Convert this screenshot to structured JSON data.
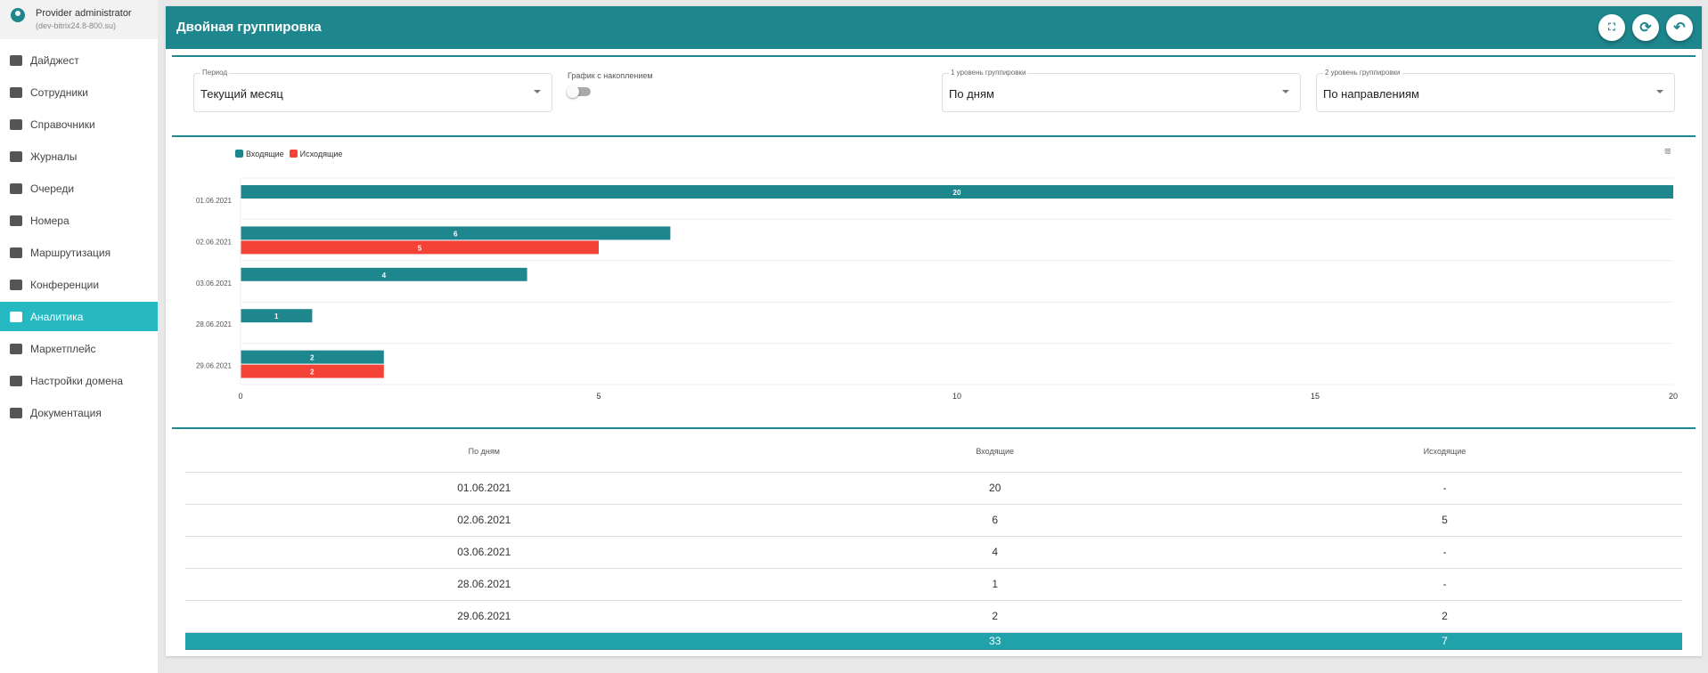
{
  "user": {
    "name": "Provider administrator",
    "domain": "(dev-bitrix24.8-800.su)"
  },
  "sidebar": {
    "items": [
      {
        "label": "Дайджест",
        "icon": "dashboard-icon"
      },
      {
        "label": "Сотрудники",
        "icon": "people-icon"
      },
      {
        "label": "Справочники",
        "icon": "folder-icon"
      },
      {
        "label": "Журналы",
        "icon": "book-icon"
      },
      {
        "label": "Очереди",
        "icon": "queue-icon"
      },
      {
        "label": "Номера",
        "icon": "phone-icon"
      },
      {
        "label": "Маршрутизация",
        "icon": "routing-icon"
      },
      {
        "label": "Конференции",
        "icon": "conference-icon"
      },
      {
        "label": "Аналитика",
        "icon": "chart-icon",
        "active": true
      },
      {
        "label": "Маркетплейс",
        "icon": "basket-icon"
      },
      {
        "label": "Настройки домена",
        "icon": "gear-icon"
      },
      {
        "label": "Документация",
        "icon": "docs-icon"
      }
    ]
  },
  "header": {
    "title": "Двойная группировка",
    "buttons": [
      "fullscreen-icon",
      "refresh-icon",
      "back-icon"
    ]
  },
  "filters": {
    "period": {
      "label": "Период",
      "value": "Текущий месяц"
    },
    "accumulate": {
      "label": "График с накоплением",
      "on": false
    },
    "level1": {
      "label": "1 уровень группировки",
      "value": "По дням"
    },
    "level2": {
      "label": "2 уровень группировки",
      "value": "По направлениям"
    }
  },
  "colors": {
    "accent": "#1e878d",
    "active": "#26b9c2",
    "incoming": "#1e878d",
    "outgoing": "#f44336",
    "total": "#21a1a9"
  },
  "chart_data": {
    "type": "bar",
    "orientation": "horizontal",
    "categories": [
      "01.06.2021",
      "02.06.2021",
      "03.06.2021",
      "28.06.2021",
      "29.06.2021"
    ],
    "series": [
      {
        "name": "Входящие",
        "values": [
          20,
          6,
          4,
          1,
          2
        ]
      },
      {
        "name": "Исходящие",
        "values": [
          null,
          5,
          null,
          null,
          2
        ]
      }
    ],
    "xlim": [
      0,
      20
    ],
    "xticks": [
      0,
      5,
      10,
      15,
      20
    ],
    "legend": "top-left",
    "grid": true
  },
  "table": {
    "headers": [
      "По дням",
      "Входящие",
      "Исходящие"
    ],
    "rows": [
      [
        "01.06.2021",
        "20",
        "-"
      ],
      [
        "02.06.2021",
        "6",
        "5"
      ],
      [
        "03.06.2021",
        "4",
        "-"
      ],
      [
        "28.06.2021",
        "1",
        "-"
      ],
      [
        "29.06.2021",
        "2",
        "2"
      ]
    ],
    "total": [
      "",
      "33",
      "7"
    ]
  }
}
